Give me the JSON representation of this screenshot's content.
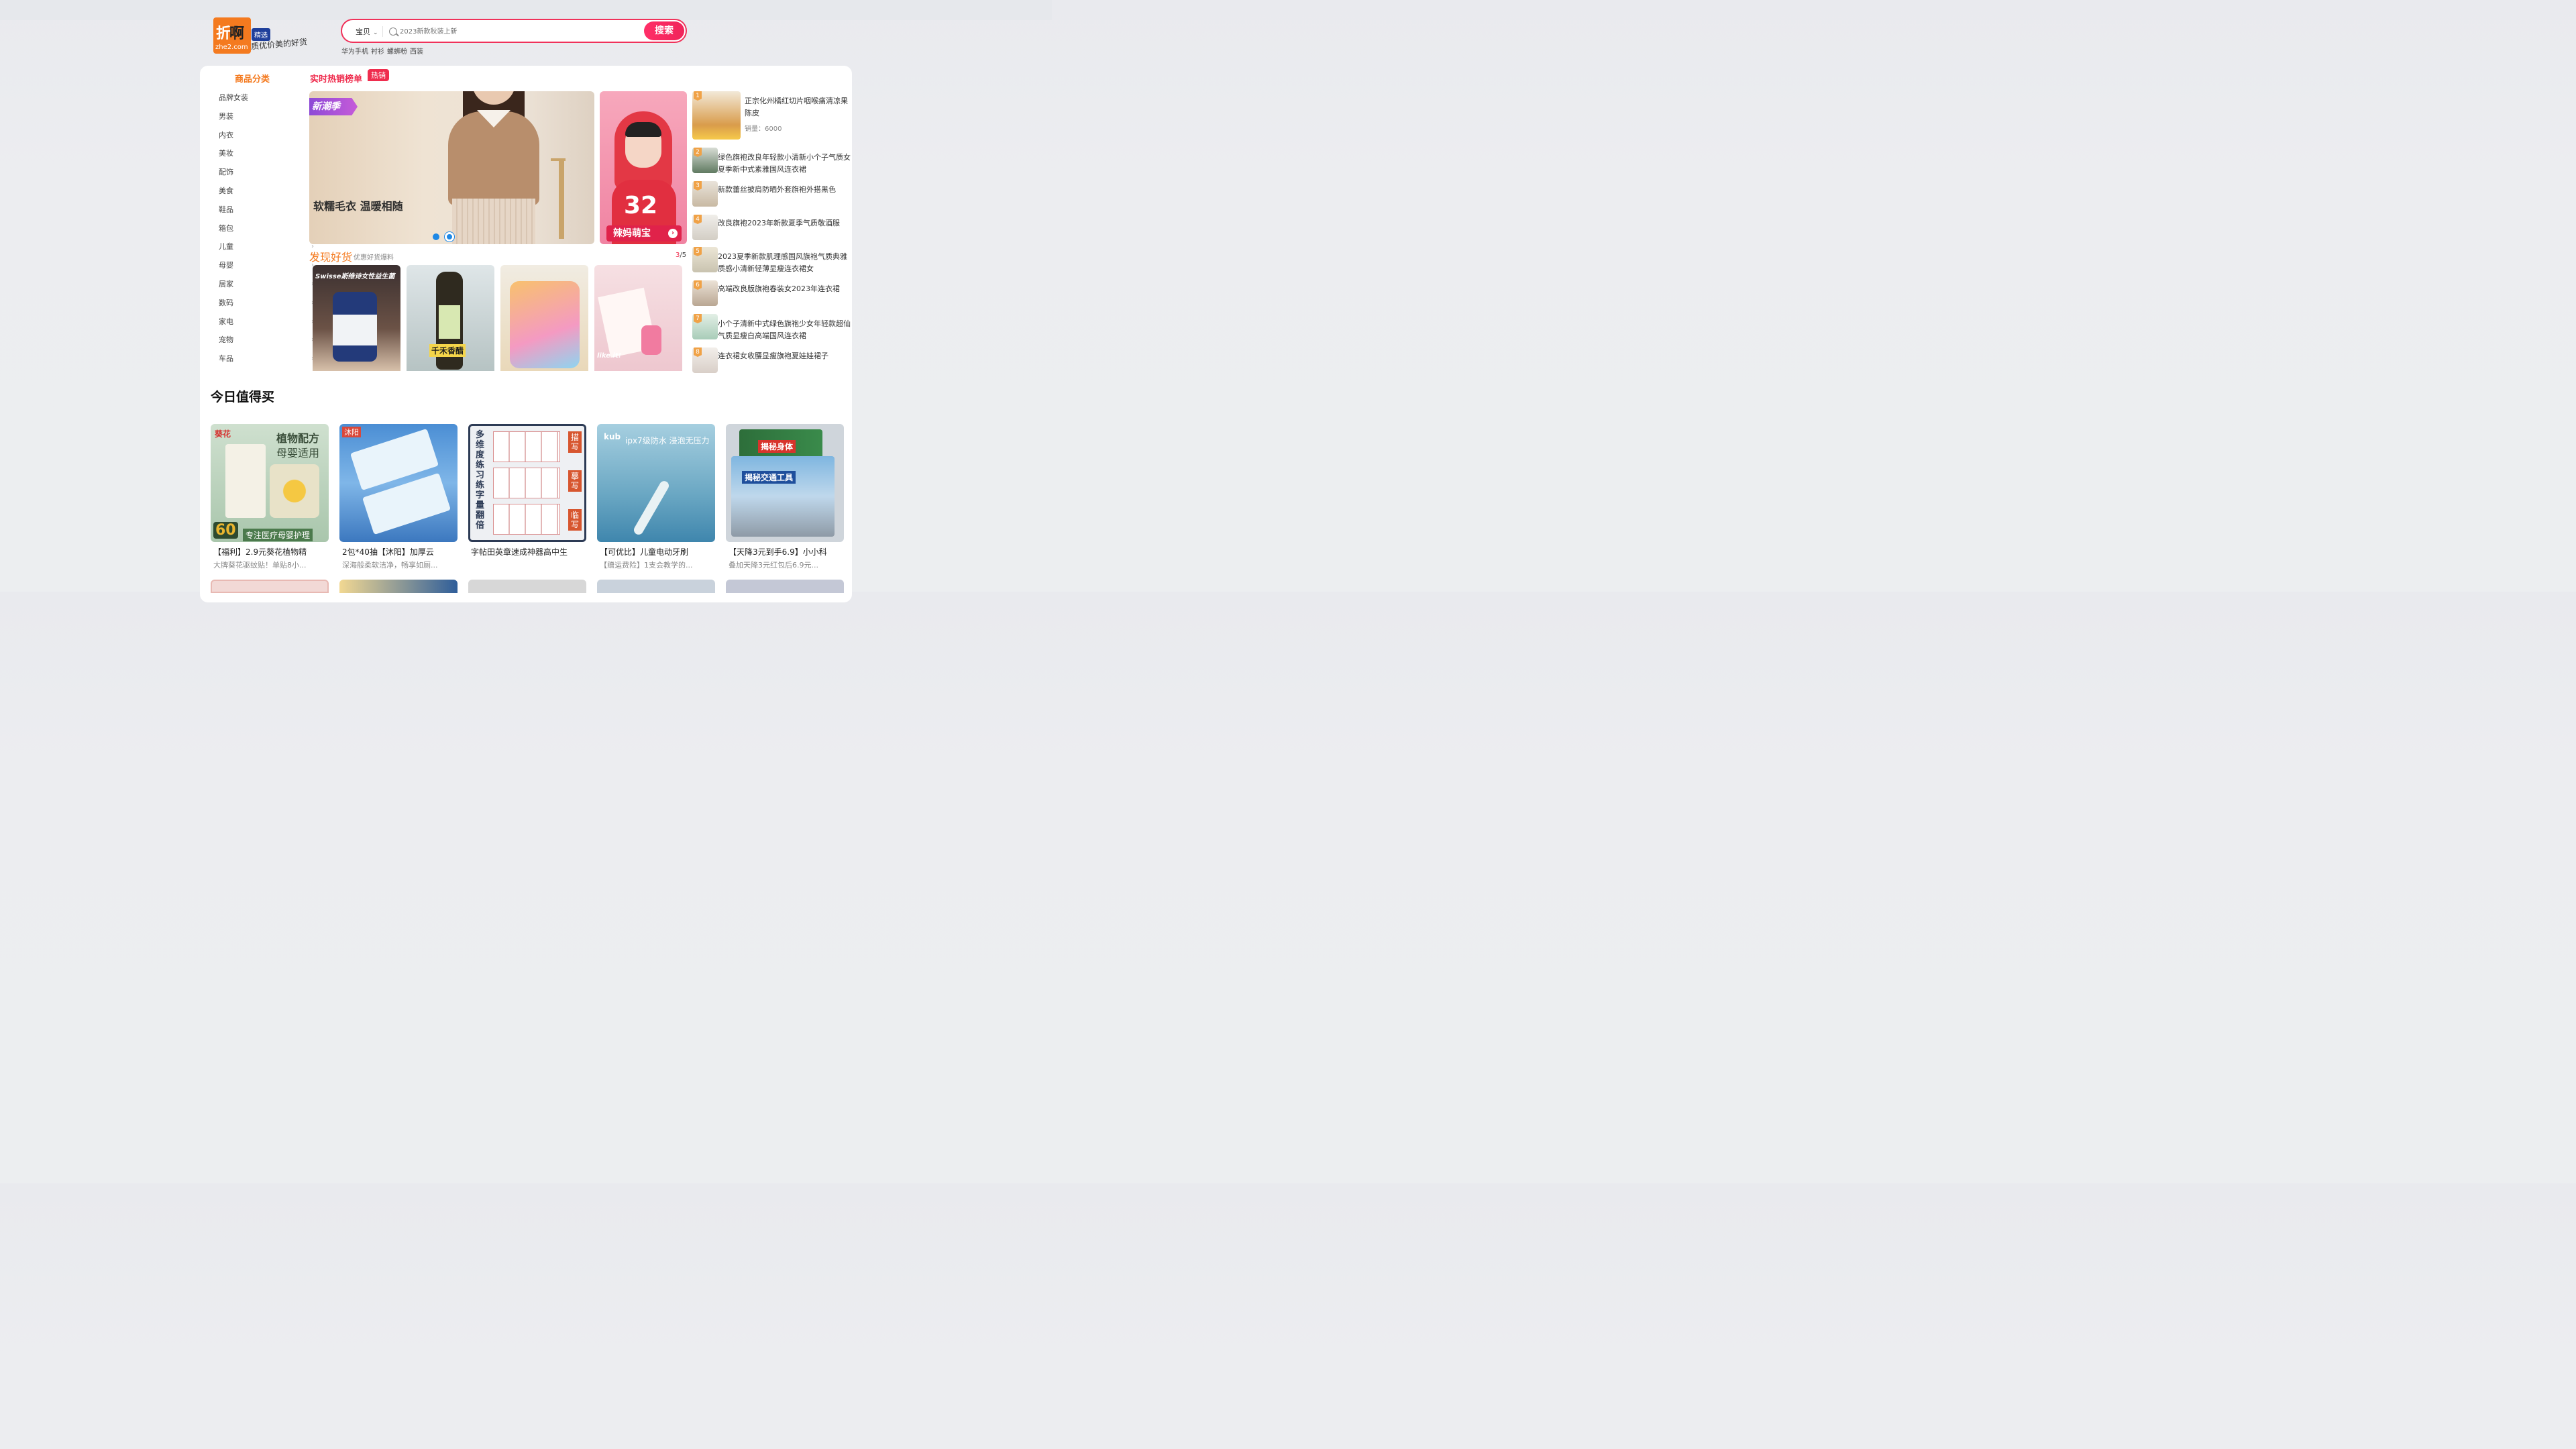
{
  "header": {
    "logo": {
      "main": "折",
      "accent": "啊",
      "url": "zhe2.com",
      "tag": "精选",
      "slogan": "质优价美的好货"
    },
    "search": {
      "category": "宝贝",
      "placeholder": "2023新款秋装上新",
      "button": "搜索"
    },
    "hot_words": [
      "华为手机",
      "衬衫",
      "螺蛳粉",
      "西装"
    ]
  },
  "categories": {
    "title": "商品分类",
    "items": [
      "品牌女装",
      "男装",
      "内衣",
      "美妆",
      "配饰",
      "美食",
      "鞋品",
      "箱包",
      "儿童",
      "母婴",
      "居家",
      "数码",
      "家电",
      "宠物",
      "车品"
    ]
  },
  "ranking": {
    "title": "实时热销榜单",
    "badge": "热销",
    "items": [
      {
        "rank": "1",
        "title": "正宗化州橘红切片咽喉痛清凉果陈皮",
        "sales": "销量：6000"
      },
      {
        "rank": "2",
        "title": "绿色旗袍改良年轻款小清新小个子气质女夏季新中式素雅国风连衣裙"
      },
      {
        "rank": "3",
        "title": "新款蕾丝披肩防晒外套旗袍外搭黑色"
      },
      {
        "rank": "4",
        "title": "改良旗袍2023年新款夏季气质敬酒服"
      },
      {
        "rank": "5",
        "title": "2023夏季新款肌理感国风旗袍气质典雅质感小清新轻薄显瘦连衣裙女"
      },
      {
        "rank": "6",
        "title": "高端改良版旗袍春装女2023年连衣裙"
      },
      {
        "rank": "7",
        "title": "小个子清新中式绿色旗袍少女年轻款超仙气质显瘦白高端国风连衣裙"
      },
      {
        "rank": "8",
        "title": "连衣裙女收腰显瘦旗袍夏娃娃裙子"
      }
    ]
  },
  "banner": {
    "main_tag": "新潮季",
    "main_text": "软糯毛衣 温暖相随",
    "side_number": "32",
    "side_label": "辣妈萌宝"
  },
  "discover": {
    "title": "发现好货",
    "subtitle": "优惠好货爆料",
    "page_current": "3",
    "page_total": "/5",
    "cards": [
      "Swisse斯维诗女性益生菌",
      "千禾香醋",
      "",
      "like it!"
    ]
  },
  "worth": {
    "title": "今日值得买",
    "items": [
      {
        "title": "【福利】2.9元葵花植物精",
        "desc": "大牌葵花驱蚊贴！单贴8小...",
        "img_head": "植物配方",
        "img_sub": "母婴适用",
        "img_badge": "60",
        "img_foot": "专注医疗母婴护理",
        "brand": "葵花"
      },
      {
        "title": "2包*40抽【沐阳】加厚云",
        "desc": "深海般柔软洁净，畅享如厕...",
        "brand": "沐阳"
      },
      {
        "title": "字帖田英章速成神器高中生",
        "desc": "",
        "img_left": "多维度练习 练字量翻倍",
        "img_tags": [
          "描写",
          "摹写",
          "临写"
        ]
      },
      {
        "title": "【可优比】儿童电动牙刷",
        "desc": "【赠运费险】1支会教学的...",
        "img_head": "ipx7级防水 浸泡无压力",
        "brand": "kub"
      },
      {
        "title": "【天降3元到手6.9】小小科",
        "desc": "叠加天降3元红包后6.9元...",
        "img_head": "揭秘身体",
        "img_sub": "揭秘交通工具"
      }
    ]
  },
  "colors": {
    "accent": "#ef2d4e",
    "brand_orange": "#f47a1f",
    "search_border": "#f0325a"
  }
}
